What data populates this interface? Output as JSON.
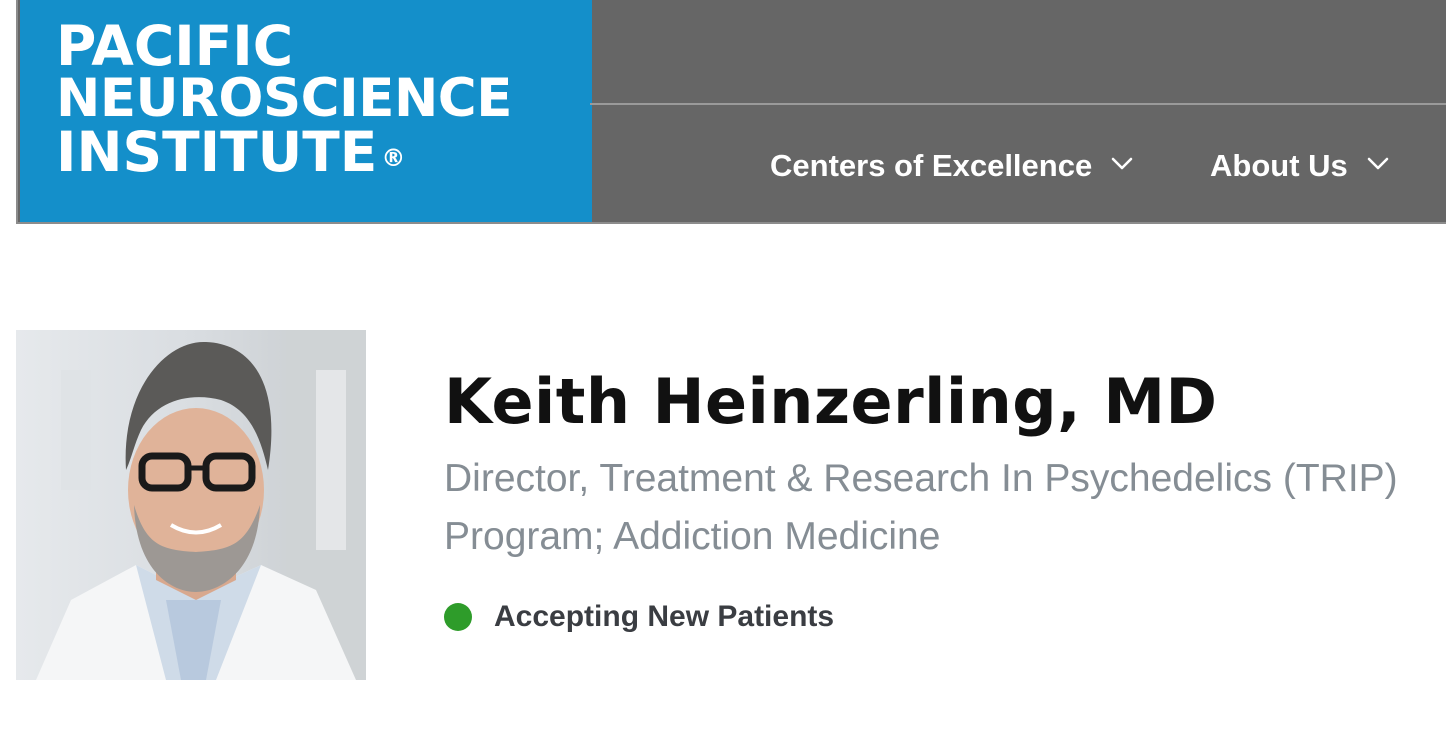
{
  "header": {
    "logo": {
      "line1": "PACIFIC",
      "line2": "NEUROSCIENCE",
      "line3": "INSTITUTE",
      "registered_mark": "®"
    },
    "nav": [
      {
        "label": "Centers of Excellence",
        "icon": "chevron-down-icon"
      },
      {
        "label": "About Us",
        "icon": "chevron-down-icon"
      }
    ],
    "colors": {
      "logo_background": "#148fca",
      "nav_background": "#666666",
      "nav_text": "#ffffff"
    }
  },
  "profile": {
    "name": "Keith Heinzerling, MD",
    "title": "Director, Treatment & Research In Psychedelics (TRIP) Program; Addiction Medicine",
    "status": {
      "label": "Accepting New Patients",
      "color": "#2e9c2a"
    }
  }
}
